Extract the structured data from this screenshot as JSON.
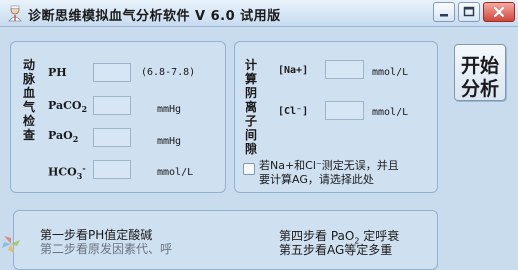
{
  "window": {
    "title": "诊断思维模拟血气分析软件 V 6.0  试用版",
    "icon": "doctor-icon"
  },
  "blood_gas": {
    "section_label": [
      "动",
      "脉",
      "血",
      "气",
      "检",
      "查"
    ],
    "ph": {
      "label": "PH",
      "value": "",
      "range": "(6.8-7.8)"
    },
    "paco2": {
      "label_main": "PaCO",
      "label_sub": "2",
      "value": "",
      "unit": "mmHg"
    },
    "pao2": {
      "label_main": "PaO",
      "label_sub": "2",
      "value": "",
      "unit": "mmHg"
    },
    "hco3": {
      "label_main": "HCO",
      "label_sub": "3",
      "label_sup": "-",
      "value": "",
      "unit": "mmol/L"
    }
  },
  "anion_gap": {
    "section_label": [
      "计",
      "算",
      "阴",
      "离",
      "子",
      "间",
      "隙"
    ],
    "na": {
      "label": "[Na+]",
      "value": "",
      "unit": "mmol/L"
    },
    "cl": {
      "label": "[Cl⁻]",
      "value": "",
      "unit": "mmol/L"
    },
    "checkbox": {
      "line1": "若Na+和Cl⁻测定无误，并且",
      "line2": "要计算AG，请选择此处",
      "checked": false
    }
  },
  "start_button": {
    "line1": "开始",
    "line2": "分析"
  },
  "steps": {
    "step1": "第一步看PH值定酸碱",
    "step2": "第二步看原发因素代、呼",
    "step4_pre": "第四步看 PaO",
    "step4_sub": "2",
    "step4_post": " 定呼衰",
    "step5": "第五步看AG等定多重"
  }
}
